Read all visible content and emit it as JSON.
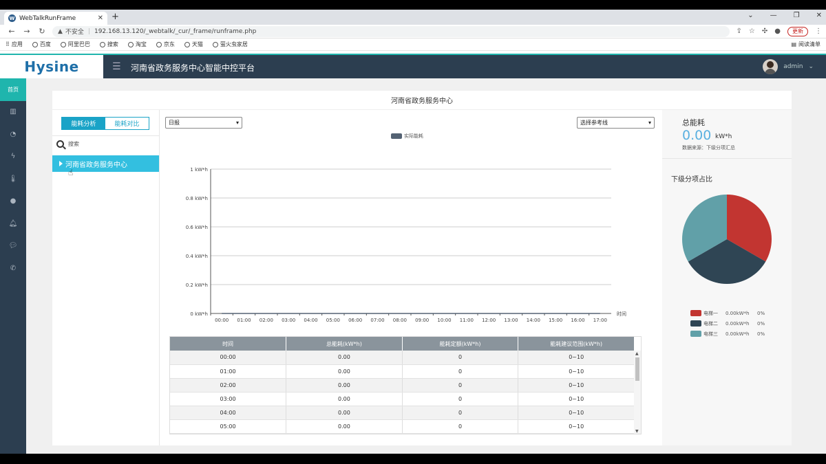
{
  "browser": {
    "tab_title": "WebTalkRunFrame",
    "url_insecure": "不安全",
    "url": "192.168.13.120/_webtalk/_cur/_frame/runframe.php",
    "update_label": "更新",
    "bookmarks": [
      "应用",
      "百度",
      "阿里巴巴",
      "搜索",
      "淘宝",
      "京东",
      "天猫",
      "萤火虫家居"
    ],
    "reading_list": "阅读清单"
  },
  "app": {
    "logo": "Hysine",
    "title": "河南省政务服务中心智能中控平台",
    "user": "admin"
  },
  "leftnav": {
    "home_label": "首页",
    "icons": [
      "bar-chart-icon",
      "dashboard-icon",
      "lightning-icon",
      "thermometer-icon",
      "user-icon",
      "bell-icon",
      "chat-icon",
      "phone-icon"
    ]
  },
  "panel": {
    "title": "河南省政务服务中心",
    "seg_analysis": "能耗分析",
    "seg_compare": "能耗对比",
    "search_placeholder": "搜索",
    "tree_node": "河南省政务服务中心",
    "period_select": "日报",
    "reference_select": "选择参考线",
    "legend": "实际能耗"
  },
  "chart_data": {
    "type": "line",
    "series": [
      {
        "name": "实际能耗",
        "values": [
          0,
          0,
          0,
          0,
          0,
          0,
          0,
          0,
          0,
          0,
          0,
          0,
          0,
          0,
          0,
          0,
          0,
          0
        ]
      }
    ],
    "categories": [
      "00:00",
      "01:00",
      "02:00",
      "03:00",
      "04:00",
      "05:00",
      "06:00",
      "07:00",
      "08:00",
      "09:00",
      "10:00",
      "11:00",
      "12:00",
      "13:00",
      "14:00",
      "15:00",
      "16:00",
      "17:00"
    ],
    "y_ticks": [
      "0 kW*h",
      "0.2 kW*h",
      "0.4 kW*h",
      "0.6 kW*h",
      "0.8 kW*h",
      "1 kW*h"
    ],
    "ylim": [
      0,
      1
    ],
    "xlabel": "时间",
    "grid": true
  },
  "table": {
    "headers": [
      "时间",
      "总能耗(kW*h)",
      "能耗定额(kW*h)",
      "能耗建议范围(kW*h)"
    ],
    "rows": [
      [
        "00:00",
        "0.00",
        "0",
        "0~10"
      ],
      [
        "01:00",
        "0.00",
        "0",
        "0~10"
      ],
      [
        "02:00",
        "0.00",
        "0",
        "0~10"
      ],
      [
        "03:00",
        "0.00",
        "0",
        "0~10"
      ],
      [
        "04:00",
        "0.00",
        "0",
        "0~10"
      ],
      [
        "05:00",
        "0.00",
        "0",
        "0~10"
      ]
    ]
  },
  "summary": {
    "total_label": "总能耗",
    "total_value": "0.00",
    "total_unit": "kW*h",
    "source": "数据来源：下级分项汇总",
    "sub_title": "下级分项占比",
    "items": [
      {
        "name": "电梯一",
        "value": "0.00kW*h",
        "pct": "0%",
        "color": "#c23531",
        "share": 0.3333
      },
      {
        "name": "电梯二",
        "value": "0.00kW*h",
        "pct": "0%",
        "color": "#2f4554",
        "share": 0.3333
      },
      {
        "name": "电梯三",
        "value": "0.00kW*h",
        "pct": "0%",
        "color": "#61a0a8",
        "share": 0.3334
      }
    ]
  }
}
